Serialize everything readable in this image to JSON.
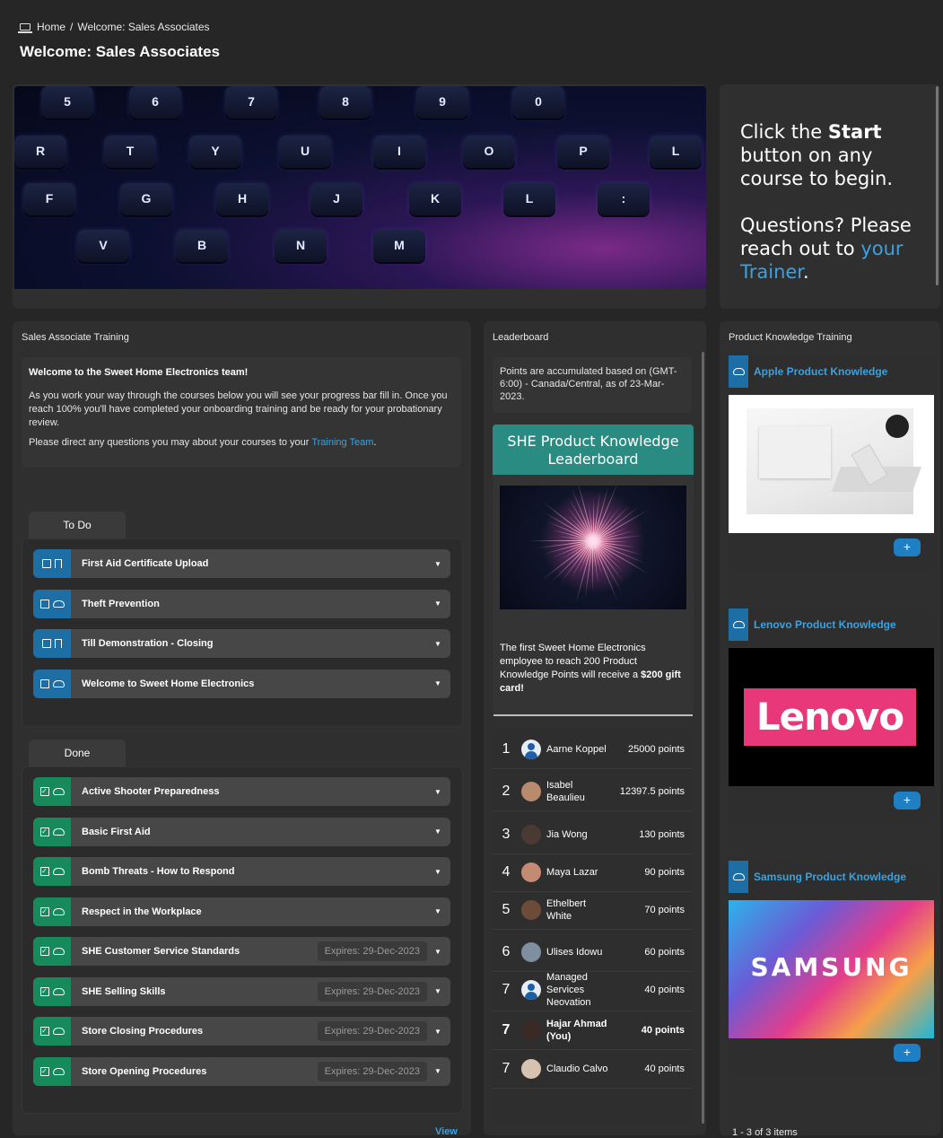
{
  "breadcrumb": {
    "home": "Home",
    "separator": "/",
    "current": "Welcome: Sales Associates"
  },
  "page_title": "Welcome: Sales Associates",
  "hero": {
    "keys": [
      "5",
      "6",
      "7",
      "8",
      "9",
      "0",
      "R",
      "T",
      "Y",
      "U",
      "I",
      "O",
      "P",
      "L",
      "F",
      "G",
      "H",
      "J",
      "K",
      "L",
      ":",
      "V",
      "B",
      "N",
      "M"
    ]
  },
  "side_message": {
    "line1_prefix": "Click the ",
    "line1_bold": "Start",
    "line1_suffix": " button on any course to begin.",
    "line2_prefix": "Questions? Please reach out to ",
    "line2_link": "your Trainer",
    "line2_suffix": "."
  },
  "sales_training": {
    "title": "Sales Associate Training",
    "intro_heading": "Welcome to the Sweet Home Electronics team!",
    "intro_p1": "As you work your way through the courses below you will see your progress bar fill in. Once you reach 100% you'll have completed your onboarding training and be ready for your probationary review.",
    "intro_p2_prefix": "Please direct any questions you may about your courses to your ",
    "intro_p2_link": "Training Team",
    "intro_p2_suffix": ".",
    "todo_tab": "To Do",
    "todo": [
      {
        "label": "First Aid Certificate Upload",
        "icon": "bookmark-icon"
      },
      {
        "label": "Theft Prevention",
        "icon": "cloud-icon"
      },
      {
        "label": "Till Demonstration - Closing",
        "icon": "bookmark-icon"
      },
      {
        "label": "Welcome to Sweet Home Electronics",
        "icon": "cloud-icon"
      }
    ],
    "done_tab": "Done",
    "done": [
      {
        "label": "Active Shooter Preparedness",
        "expires": ""
      },
      {
        "label": "Basic First Aid",
        "expires": ""
      },
      {
        "label": "Bomb Threats - How to Respond",
        "expires": ""
      },
      {
        "label": "Respect in the Workplace",
        "expires": ""
      },
      {
        "label": "SHE Customer Service Standards",
        "expires": "Expires: 29-Dec-2023"
      },
      {
        "label": "SHE Selling Skills",
        "expires": "Expires: 29-Dec-2023"
      },
      {
        "label": "Store Closing Procedures",
        "expires": "Expires: 29-Dec-2023"
      },
      {
        "label": "Store Opening Procedures",
        "expires": "Expires: 29-Dec-2023"
      }
    ],
    "view_link": "View"
  },
  "leaderboard": {
    "title": "Leaderboard",
    "note": "Points are accumulated based on (GMT-6:00) - Canada/Central, as of 23-Mar-2023.",
    "card_title": "SHE Product Knowledge Leaderboard",
    "card_text_prefix": "The first Sweet Home Electronics employee to reach 200 Product Knowledge Points will receive a ",
    "card_text_bold": "$200 gift card!",
    "rows": [
      {
        "rank": "1",
        "name": "Aarne Koppel",
        "points": "25000 points",
        "avatar": "placeholder",
        "me": false
      },
      {
        "rank": "2",
        "name": "Isabel Beaulieu",
        "points": "12397.5 points",
        "avatar": "#b98a6e",
        "me": false
      },
      {
        "rank": "3",
        "name": "Jia Wong",
        "points": "130 points",
        "avatar": "#4a3a34",
        "me": false
      },
      {
        "rank": "4",
        "name": "Maya Lazar",
        "points": "90 points",
        "avatar": "#c48a74",
        "me": false
      },
      {
        "rank": "5",
        "name": "Ethelbert White",
        "points": "70 points",
        "avatar": "#6e4a38",
        "me": false
      },
      {
        "rank": "6",
        "name": "Ulises Idowu",
        "points": "60 points",
        "avatar": "#7e8fa0",
        "me": false
      },
      {
        "rank": "7",
        "name": "Managed Services Neovation",
        "points": "40 points",
        "avatar": "placeholder",
        "me": false
      },
      {
        "rank": "7",
        "name": "Hajar Ahmad (You)",
        "points": "40 points",
        "avatar": "#3a2a26",
        "me": true
      },
      {
        "rank": "7",
        "name": "Claudio Calvo",
        "points": "40 points",
        "avatar": "#d7c2b2",
        "me": false
      }
    ]
  },
  "product_training": {
    "title": "Product Knowledge Training",
    "items": [
      {
        "title": "Apple Product Knowledge",
        "image": "apple-desk-image"
      },
      {
        "title": "Lenovo Product Knowledge",
        "image": "lenovo-logo-image",
        "logo_text": "Lenovo"
      },
      {
        "title": "Samsung Product Knowledge",
        "image": "samsung-logo-image",
        "logo_text": "SAMSUNG"
      }
    ],
    "add_label": "+",
    "footer": "1 - 3 of 3 items"
  },
  "colors": {
    "accent": "#3aa2e0",
    "todo_badge": "#1e6ea6",
    "done_badge": "#178a5c",
    "leaderboard_header": "#2a8b82",
    "lenovo": "#e8387a"
  }
}
